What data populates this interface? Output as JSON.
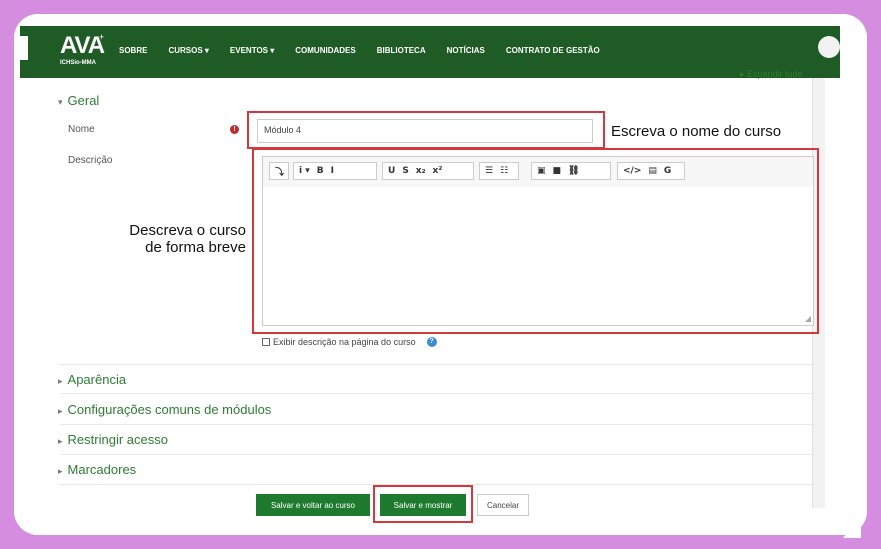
{
  "nav": {
    "logo": "AVA",
    "logo_sub": "ICHSio-MMA",
    "logo_plus": "+",
    "items": [
      "SOBRE",
      "CURSOS ▾",
      "EVENTOS ▾",
      "COMUNIDADES",
      "BIBLIOTECA",
      "NOTÍCIAS",
      "CONTRATO DE GESTÃO"
    ]
  },
  "expand_all": "▸ Expandir tudo",
  "sections": {
    "geral": "Geral",
    "aparencia": "Aparência",
    "config": "Configurações comuns de módulos",
    "restringir": "Restringir acesso",
    "marcadores": "Marcadores"
  },
  "form": {
    "nome_label": "Nome",
    "nome_value": "Módulo 4",
    "required_icon": "!",
    "descricao_label": "Descrição",
    "show_desc_label": "Exibir descrição na página do curso",
    "help_icon": "?"
  },
  "toolbar": [
    "⤵",
    "i ▾",
    "B",
    "I",
    "U",
    "S",
    "x₂",
    "x²",
    "☰",
    "☷",
    "▣",
    "■",
    "⛓",
    "</>",
    "▤",
    "G"
  ],
  "annotations": {
    "name": "Escreva o nome do curso",
    "desc_line1": "Descreva o curso",
    "desc_line2": "de forma breve"
  },
  "buttons": {
    "save_return": "Salvar e voltar ao curso",
    "save_show": "Salvar e mostrar",
    "cancel": "Cancelar"
  },
  "colors": {
    "background": "#d58de0",
    "navbar": "#1e5b25",
    "accent_green": "#2e7d32",
    "highlight": "#d4373c"
  }
}
